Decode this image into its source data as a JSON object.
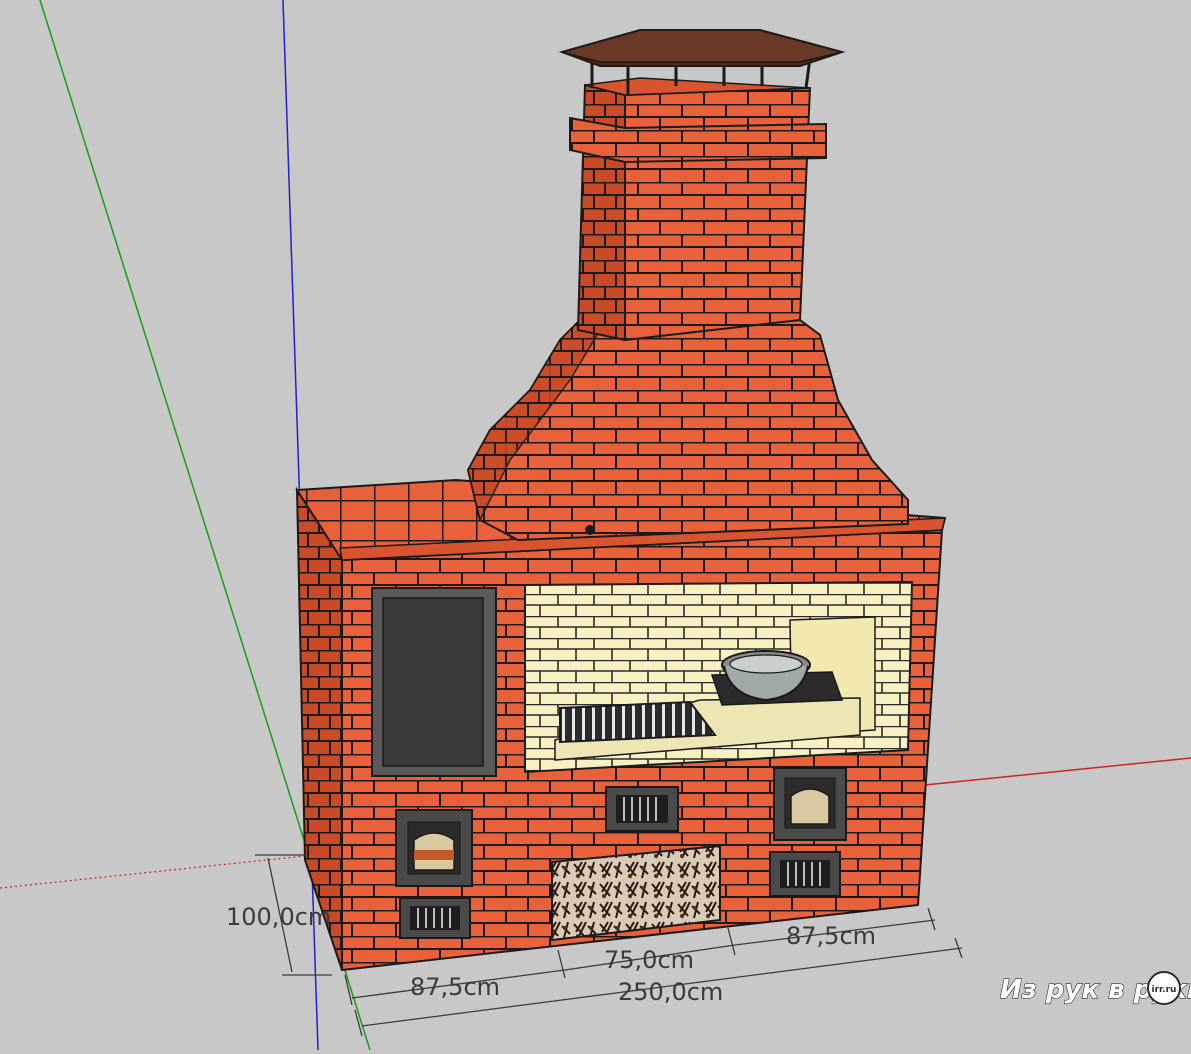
{
  "dimensions": {
    "height": "100,0cm",
    "left_width": "87,5cm",
    "middle_width": "75,0cm",
    "right_width": "87,5cm",
    "total_width": "250,0cm"
  },
  "watermark": {
    "text": "Из рук в руки",
    "badge": "irr.ru"
  },
  "colors": {
    "background": "#c8c8c8",
    "brick": "#e8613a",
    "brick_dark": "#c94a26",
    "firebrick": "#f7f1c2",
    "metal": "#3a3a3a",
    "roof": "#6b3a26",
    "axis_green": "#1a9a1a",
    "axis_blue": "#2222cc",
    "axis_red": "#cc2222"
  }
}
